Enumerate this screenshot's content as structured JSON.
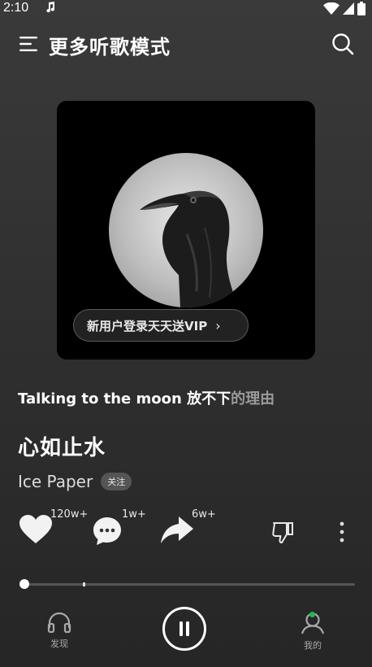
{
  "status_bar": {
    "time": "2:10",
    "icons": [
      "music-note-icon",
      "wifi-icon",
      "signal-icon",
      "battery-icon"
    ]
  },
  "header": {
    "title": "更多听歌模式",
    "menu_icon": "menu-icon",
    "search_icon": "search-icon"
  },
  "cover": {
    "image": "raven-photo",
    "vip_promo": "新用户登录天天送VIP",
    "vip_arrow": "›"
  },
  "lyric": {
    "played": "Talking to the moon 放不下",
    "remaining": "的理由"
  },
  "song": {
    "title": "心如止水",
    "artist": "Ice Paper",
    "follow_label": "关注"
  },
  "actions": {
    "like_count": "120w+",
    "comment_count": "1w+",
    "share_count": "6w+",
    "icons": [
      "heart-icon",
      "comment-icon",
      "share-icon",
      "dislike-icon",
      "more-icon"
    ]
  },
  "progress": {
    "played_fraction": 0.004,
    "buffered_fraction": 0.18
  },
  "bottom_nav": {
    "discover_label": "发现",
    "mine_label": "我的",
    "play_state": "playing"
  },
  "colors": {
    "accent_dot": "#1db954",
    "background": "#333333"
  }
}
